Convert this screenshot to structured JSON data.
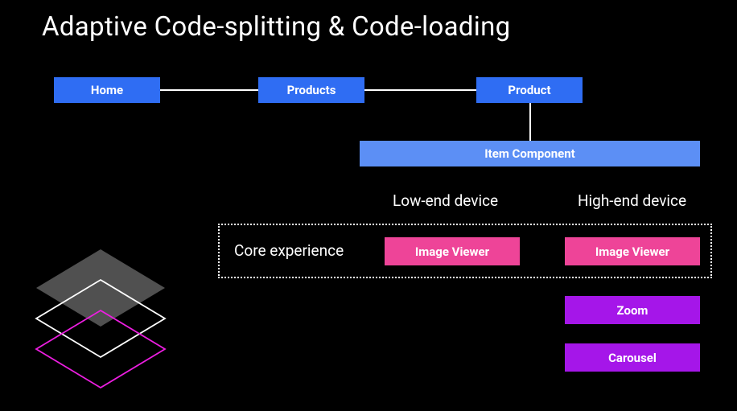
{
  "title": "Adaptive Code-splitting & Code-loading",
  "nav": {
    "home": "Home",
    "products": "Products",
    "product": "Product"
  },
  "item_component": "Item Component",
  "headers": {
    "low": "Low-end device",
    "high": "High-end device"
  },
  "labels": {
    "core": "Core experience"
  },
  "modules": {
    "img_lo": "Image Viewer",
    "img_hi": "Image Viewer",
    "zoom": "Zoom",
    "carousel": "Carousel"
  }
}
